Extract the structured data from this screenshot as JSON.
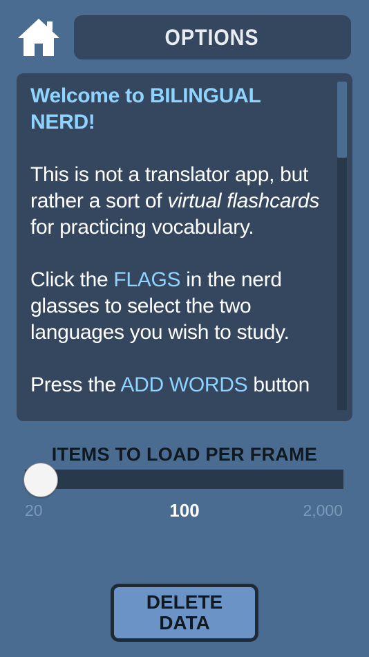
{
  "header": {
    "home_icon": "home-icon",
    "title": "OPTIONS"
  },
  "panel": {
    "welcome": "Welcome to BILINGUAL NERD!",
    "para1": {
      "a": "This is not a translator app, but rather a sort of ",
      "b": "virtual flashcards",
      "c": " for practicing vocabulary."
    },
    "para2": {
      "a": "Click the ",
      "b": "FLAGS",
      "c": " in the nerd glasses to select the two languages you wish to study."
    },
    "para3": {
      "a": "Press the ",
      "b": "ADD WORDS",
      "c": " button"
    },
    "scroll_position": 0
  },
  "slider": {
    "label": "ITEMS TO LOAD PER FRAME",
    "min_label": "20",
    "value_label": "100",
    "max_label": "2,000",
    "min": 20,
    "max": 2000,
    "value": 100
  },
  "delete_button": {
    "label": "DELETE\nDATA"
  },
  "colors": {
    "background": "#4a6c90",
    "panel": "#34475e",
    "highlight": "#8fd3ff",
    "button": "#6b93c5"
  }
}
